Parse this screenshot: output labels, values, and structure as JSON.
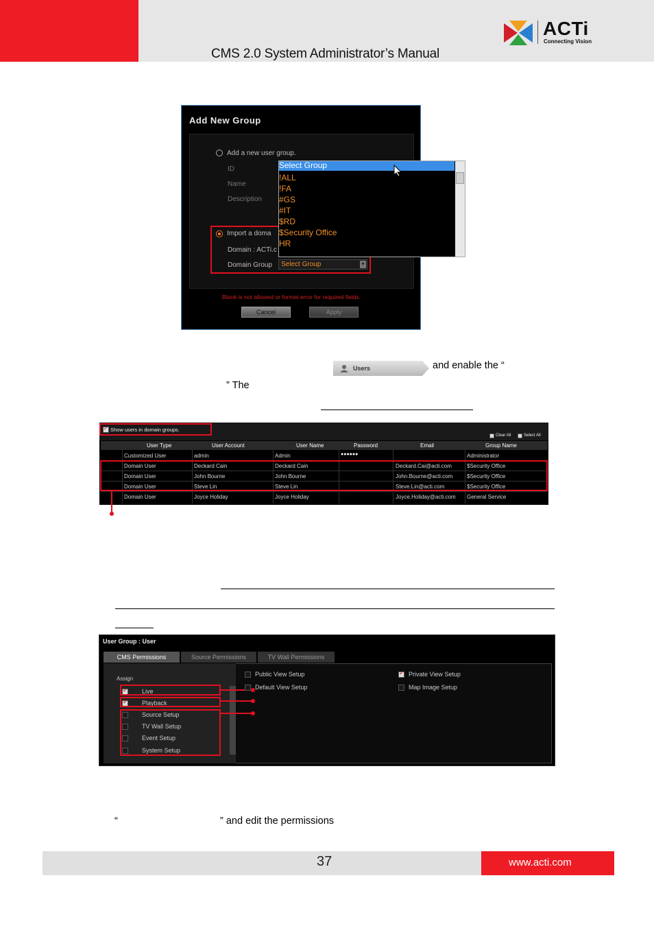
{
  "header": {
    "title": "CMS 2.0 System Administrator’s Manual",
    "logo_name": "ACTi",
    "logo_tagline": "Connecting Vision"
  },
  "add_group_dialog": {
    "title": "Add New Group",
    "option_new": "Add a new user group.",
    "field_id": "ID",
    "field_name": "Name",
    "field_description": "Description",
    "option_import": "Import a doma",
    "domain_label": "Domain : ACTi.c",
    "domain_group_label": "Domain Group",
    "domain_group_value": "Select Group",
    "error": "Blank is not allowed or format error for required fields.",
    "cancel": "Cancel",
    "apply": "Apply",
    "dropdown_options": [
      "Select Group",
      "!ALL",
      "!FA",
      "#GS",
      "#IT",
      "$RD",
      "$Security Office",
      "HR"
    ]
  },
  "text": {
    "line1_end": "and enable the “",
    "line2": "” The",
    "line3_end": "” and edit the permissions"
  },
  "users_button": {
    "label": "Users"
  },
  "users_table": {
    "show_domain": "Show users in domain groups.",
    "clear_all": "Clear All",
    "select_all": "Select All",
    "headers": [
      "User Type",
      "User Account",
      "User Name",
      "Password",
      "Email",
      "Group Name"
    ],
    "rows": [
      [
        "Customized User",
        "admin",
        "Admin",
        "●●●●●●",
        "",
        "Administrator"
      ],
      [
        "Domain User",
        "Deckard Cain",
        "Deckard Cain",
        "",
        "Deckard.Cai@acti.com",
        "$Security Office"
      ],
      [
        "Domain User",
        "John Bourne",
        "John Bourne",
        "",
        "John.Bourne@acti.com",
        "$Security Office"
      ],
      [
        "Domain User",
        "Steve Lin",
        "Steve Lin",
        "",
        "Steve.Lin@acti.com",
        "$Security Office"
      ],
      [
        "Domain User",
        "Joyce Holiday",
        "Joyce Holiday",
        "",
        "Joyce.Holiday@acti.com",
        "General Service"
      ]
    ]
  },
  "permissions": {
    "title": "User Group : User",
    "tabs": [
      "CMS Permissions",
      "Source Permissions",
      "TV Wall Permissions"
    ],
    "assign": "Assign",
    "items": [
      {
        "label": "Live",
        "checked": true
      },
      {
        "label": "Playback",
        "checked": true
      },
      {
        "label": "Source Setup",
        "checked": false
      },
      {
        "label": "TV Wall Setup",
        "checked": false
      },
      {
        "label": "Event Setup",
        "checked": false
      },
      {
        "label": "System Setup",
        "checked": false
      }
    ],
    "options": [
      {
        "label": "Public View Setup",
        "checked": false
      },
      {
        "label": "Default View Setup",
        "checked": false
      },
      {
        "label": "Private View Setup",
        "checked": true
      },
      {
        "label": "Map Image Setup",
        "checked": false
      }
    ]
  },
  "footer": {
    "page": "37",
    "site": "www.acti.com"
  },
  "colors": {
    "brand_red": "#ee1c25",
    "accent_orange": "#f0902a",
    "highlight_blue": "#3a8ee6"
  }
}
